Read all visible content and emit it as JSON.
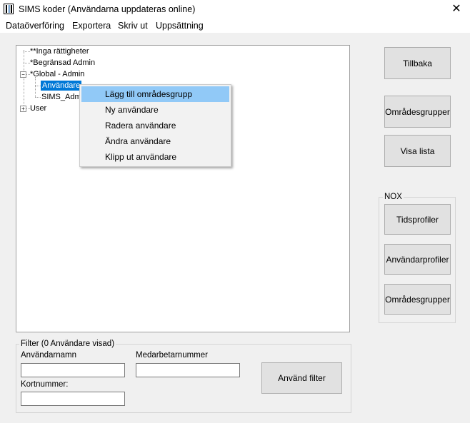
{
  "window": {
    "title": "SIMS koder (Användarna uppdateras online)"
  },
  "menu": {
    "items": [
      "Dataöverföring",
      "Exportera",
      "Skriv ut",
      "Uppsättning"
    ]
  },
  "tree": {
    "nodes": [
      "**Inga rättigheter",
      "*Begränsad Admin",
      "*Global - Admin",
      "Användare",
      "SIMS_Admin",
      "User"
    ]
  },
  "context_menu": {
    "items": [
      "Lägg till områdesgrupp",
      "Ny användare",
      "Radera användare",
      "Ändra användare",
      "Klipp ut användare"
    ],
    "highlighted": "Lägg till områdesgrupp"
  },
  "right_buttons": {
    "back": "Tillbaka",
    "area_groups": "Områdesgrupper",
    "show_list": "Visa lista"
  },
  "nox": {
    "label": "NOX",
    "buttons": {
      "time_profiles": "Tidsprofiler",
      "user_profiles": "Användarprofiler",
      "area_groups": "Områdesgrupper"
    }
  },
  "filter": {
    "label": "Filter (0 Användare visad)",
    "username_label": "Användarnamn",
    "username_value": "",
    "employee_number_label": "Medarbetarnummer",
    "employee_number_value": "",
    "card_number_label": "Kortnummer:",
    "card_number_value": "",
    "apply_button": "Använd filter"
  },
  "colors": {
    "selection": "#0078d7",
    "menu_highlight": "#91c9f7",
    "background": "#f0f0f0"
  }
}
